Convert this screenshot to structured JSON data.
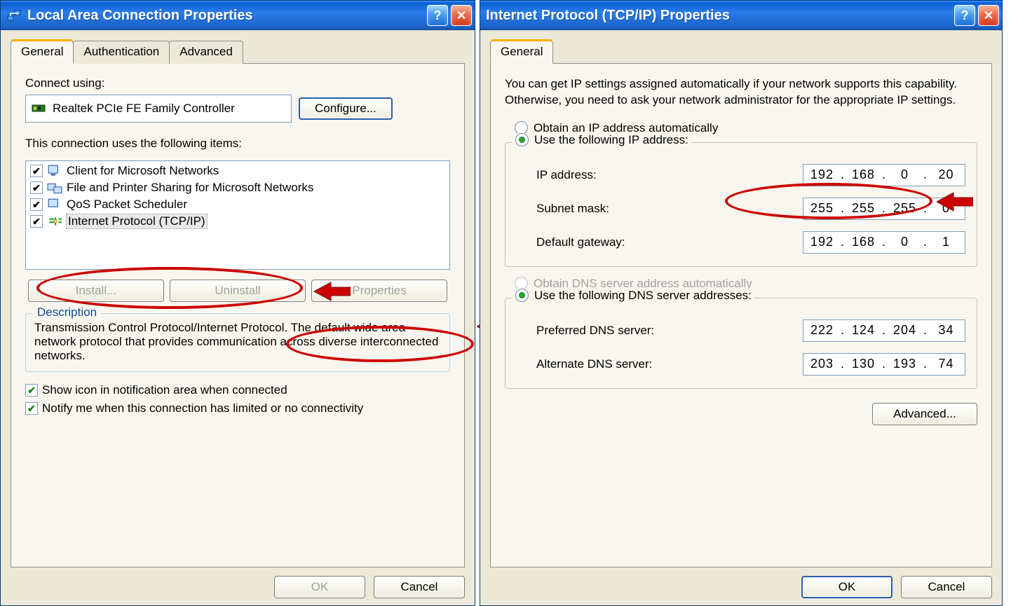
{
  "left": {
    "title": "Local Area Connection Properties",
    "tabs": [
      "General",
      "Authentication",
      "Advanced"
    ],
    "connect_label": "Connect using:",
    "adapter": "Realtek PCIe FE Family Controller",
    "configure_btn": "Configure...",
    "items_label": "This connection uses the following items:",
    "items": [
      {
        "label": "Client for Microsoft Networks",
        "checked": true
      },
      {
        "label": "File and Printer Sharing for Microsoft Networks",
        "checked": true
      },
      {
        "label": "QoS Packet Scheduler",
        "checked": true
      },
      {
        "label": "Internet Protocol (TCP/IP)",
        "checked": true,
        "selected": true
      }
    ],
    "install_btn": "Install...",
    "uninstall_btn": "Uninstall",
    "properties_btn": "Properties",
    "desc_title": "Description",
    "desc_text": "Transmission Control Protocol/Internet Protocol. The default wide area network protocol that provides communication across diverse interconnected networks.",
    "showicon_label": "Show icon in notification area when connected",
    "notify_label": "Notify me when this connection has limited or no connectivity",
    "ok": "OK",
    "cancel": "Cancel"
  },
  "right": {
    "title": "Internet Protocol (TCP/IP) Properties",
    "tab": "General",
    "intro": "You can get IP settings assigned automatically if your network supports this capability. Otherwise, you need to ask your network administrator for the appropriate IP settings.",
    "r_auto": "Obtain an IP address automatically",
    "r_manual": "Use the following IP address:",
    "ip_label": "IP address:",
    "subnet_label": "Subnet mask:",
    "gw_label": "Default gateway:",
    "ip": [
      "192",
      "168",
      "0",
      "20"
    ],
    "subnet": [
      "255",
      "255",
      "255",
      "0"
    ],
    "gw": [
      "192",
      "168",
      "0",
      "1"
    ],
    "r_dns_auto": "Obtain DNS server address automatically",
    "r_dns_manual": "Use the following DNS server addresses:",
    "pdns_label": "Preferred DNS server:",
    "adns_label": "Alternate DNS server:",
    "pdns": [
      "222",
      "124",
      "204",
      "34"
    ],
    "adns": [
      "203",
      "130",
      "193",
      "74"
    ],
    "advanced_btn": "Advanced...",
    "ok": "OK",
    "cancel": "Cancel"
  }
}
